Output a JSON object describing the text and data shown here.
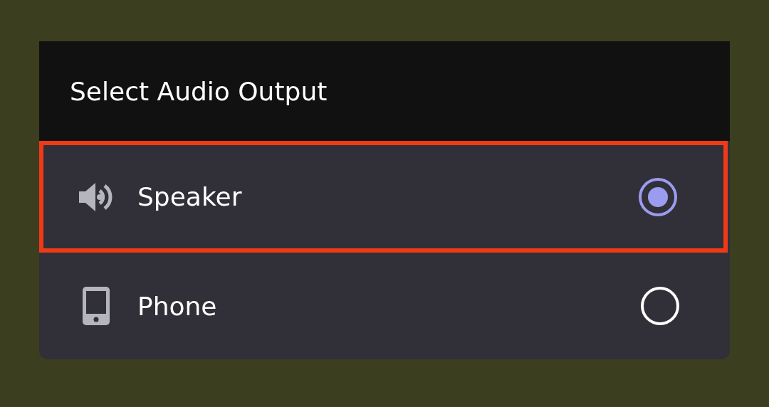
{
  "dialog": {
    "title": "Select Audio Output"
  },
  "options": [
    {
      "kind": "speaker",
      "label": "Speaker",
      "selected": true,
      "highlighted": true
    },
    {
      "kind": "phone",
      "label": "Phone",
      "selected": false,
      "highlighted": false
    }
  ]
}
